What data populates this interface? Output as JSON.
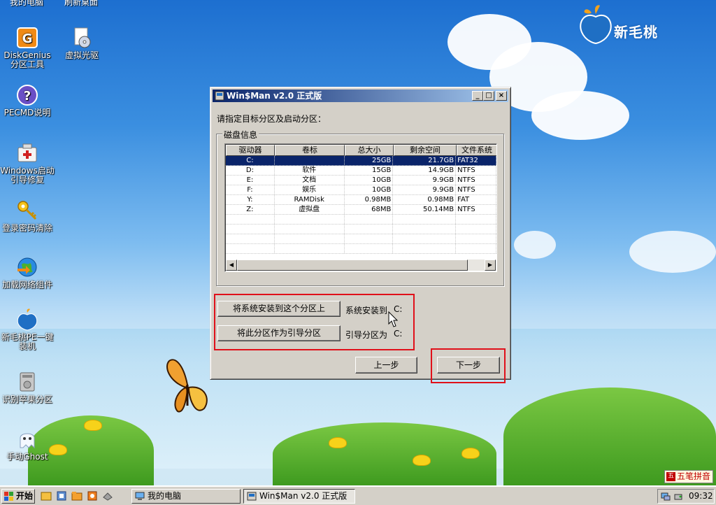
{
  "brand": {
    "name": "新毛桃",
    "leaf_color": "#f4a21b",
    "peach_color": "#1f6fc4"
  },
  "desktop": {
    "partial_labels": [
      "我的电脑",
      "刷新桌面"
    ],
    "icons": [
      {
        "label": "DiskGenius分区工具",
        "icon": "diskgenius-icon"
      },
      {
        "label": "虚拟光驱",
        "icon": "virtual-cd-icon"
      },
      {
        "label": "PECMD说明",
        "icon": "help-icon"
      },
      {
        "label": "Windows启动引导修复",
        "icon": "boot-repair-icon"
      },
      {
        "label": "登录密码清除",
        "icon": "key-icon"
      },
      {
        "label": "加载网络组件",
        "icon": "network-icon"
      },
      {
        "label": "新毛桃PE一键装机",
        "icon": "peach-install-icon"
      },
      {
        "label": "识别苹果分区",
        "icon": "apple-partition-icon"
      },
      {
        "label": "手动Ghost",
        "icon": "ghost-icon"
      }
    ]
  },
  "dialog": {
    "title": "Win$Man v2.0 正式版",
    "prompt": "请指定目标分区及启动分区：",
    "group_label": "磁盘信息",
    "columns": [
      "驱动器",
      "卷标",
      "总大小",
      "剩余空间",
      "文件系统"
    ],
    "rows": [
      {
        "drive": "C:",
        "label": "",
        "total": "25GB",
        "free": "21.7GB",
        "fs": "FAT32",
        "selected": true
      },
      {
        "drive": "D:",
        "label": "软件",
        "total": "15GB",
        "free": "14.9GB",
        "fs": "NTFS",
        "selected": false
      },
      {
        "drive": "E:",
        "label": "文档",
        "total": "10GB",
        "free": "9.9GB",
        "fs": "NTFS",
        "selected": false
      },
      {
        "drive": "F:",
        "label": "娱乐",
        "total": "10GB",
        "free": "9.9GB",
        "fs": "NTFS",
        "selected": false
      },
      {
        "drive": "Y:",
        "label": "RAMDisk",
        "total": "0.98MB",
        "free": "0.98MB",
        "fs": "FAT",
        "selected": false
      },
      {
        "drive": "Z:",
        "label": "虚拟盘",
        "total": "68MB",
        "free": "50.14MB",
        "fs": "NTFS",
        "selected": false
      }
    ],
    "install_button": "将系统安装到这个分区上",
    "install_label": "系统安装到",
    "install_value": "C:",
    "boot_button": "将此分区作为引导分区",
    "boot_label": "引导分区为",
    "boot_value": "C:",
    "prev_button": "上一步",
    "next_button": "下一步",
    "highlight_color": "#e0101a"
  },
  "taskbar": {
    "start_label": "开始",
    "tasks": [
      {
        "label": "我的电脑",
        "active": false
      },
      {
        "label": "Win$Man v2.0 正式版",
        "active": true
      }
    ],
    "clock": "09:32",
    "ime_label": "五笔拼音"
  }
}
